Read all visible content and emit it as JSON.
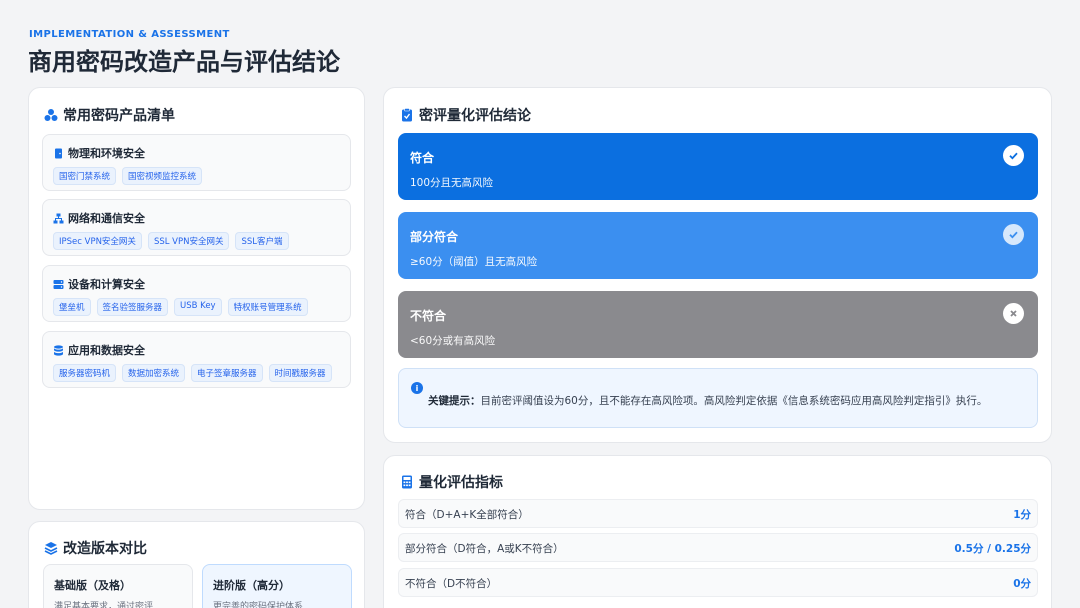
{
  "header": {
    "eyebrow": "IMPLEMENTATION & ASSESSMENT",
    "title": "商用密码改造产品与评估结论"
  },
  "products": {
    "title": "常用密码产品清单",
    "icon": "cubes-icon",
    "categories": [
      {
        "name": "物理和环境安全",
        "icon": "door-icon",
        "tags": [
          "国密门禁系统",
          "国密视频监控系统"
        ]
      },
      {
        "name": "网络和通信安全",
        "icon": "network-icon",
        "tags": [
          "IPSec VPN安全网关",
          "SSL VPN安全网关",
          "SSL客户端"
        ]
      },
      {
        "name": "设备和计算安全",
        "icon": "server-icon",
        "tags": [
          "堡垒机",
          "签名验签服务器",
          "USB Key",
          "特权账号管理系统"
        ]
      },
      {
        "name": "应用和数据安全",
        "icon": "database-icon",
        "tags": [
          "服务器密码机",
          "数据加密系统",
          "电子签章服务器",
          "时间戳服务器"
        ]
      }
    ]
  },
  "versions": {
    "title": "改造版本对比",
    "icon": "layers-icon",
    "basic": {
      "title": "基础版（及格）",
      "desc": "满足基本要求，通过密评"
    },
    "advanced": {
      "title": "进阶版（高分）",
      "desc": "更完善的密码保护体系"
    }
  },
  "conclusion": {
    "title": "密评量化评估结论",
    "icon": "clipboard-check-icon",
    "levels": [
      {
        "title": "符合",
        "desc": "100分且无高风险",
        "color": "#0b6fe0",
        "icon": "check-icon"
      },
      {
        "title": "部分符合",
        "desc": "≥60分（阈值）且无高风险",
        "color": "#3b8ff0",
        "icon": "check-icon"
      },
      {
        "title": "不符合",
        "desc": "<60分或有高风险",
        "color": "#8a8a8e",
        "icon": "close-icon"
      }
    ],
    "hint_label": "关键提示：",
    "hint_text": "目前密评阈值设为60分，且不能存在高风险项。高风险判定依据《信息系统密码应用高风险判定指引》执行。"
  },
  "metrics": {
    "title": "量化评估指标",
    "icon": "calculator-icon",
    "rows": [
      {
        "label": "符合（D+A+K全部符合）",
        "value": "1分"
      },
      {
        "label": "部分符合（D符合，A或K不符合）",
        "value": "0.5分 / 0.25分"
      },
      {
        "label": "不符合（D不符合）",
        "value": "0分"
      }
    ]
  }
}
